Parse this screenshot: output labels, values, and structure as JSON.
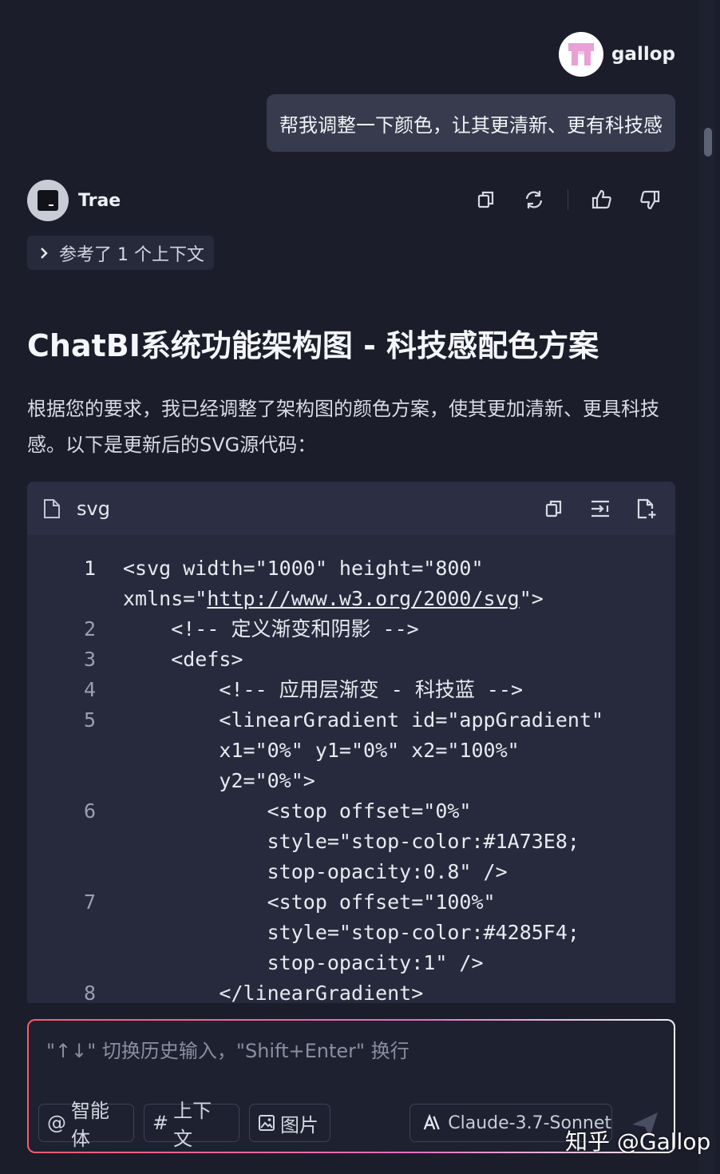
{
  "user": {
    "name": "gallop",
    "message": "帮我调整一下颜色，让其更清新、更有科技感"
  },
  "assistant": {
    "name": "Trae",
    "context_label": "参考了 1 个上下文",
    "title": "ChatBI系统功能架构图 - 科技感配色方案",
    "intro": "根据您的要求，我已经调整了架构图的颜色方案，使其更加清新、更具科技感。以下是更新后的SVG源代码："
  },
  "code": {
    "lang": "svg",
    "lines": [
      {
        "num": "1",
        "rows": [
          "<svg width=\"1000\" height=\"800\"",
          "xmlns=\"http://www.w3.org/2000/svg\">"
        ]
      },
      {
        "num": "2",
        "rows": [
          "    <!-- 定义渐变和阴影 -->"
        ]
      },
      {
        "num": "3",
        "rows": [
          "    <defs>"
        ]
      },
      {
        "num": "4",
        "rows": [
          "        <!-- 应用层渐变 - 科技蓝 -->"
        ]
      },
      {
        "num": "5",
        "rows": [
          "        <linearGradient id=\"appGradient\"",
          "        x1=\"0%\" y1=\"0%\" x2=\"100%\"",
          "        y2=\"0%\">"
        ]
      },
      {
        "num": "6",
        "rows": [
          "            <stop offset=\"0%\"",
          "            style=\"stop-color:#1A73E8;",
          "            stop-opacity:0.8\" />"
        ]
      },
      {
        "num": "7",
        "rows": [
          "            <stop offset=\"100%\"",
          "            style=\"stop-color:#4285F4;",
          "            stop-opacity:1\" />"
        ]
      },
      {
        "num": "8",
        "rows": [
          "        </linearGradient>"
        ]
      }
    ]
  },
  "input": {
    "placeholder": "\"↑↓\" 切换历史输入，\"Shift+Enter\" 换行",
    "chips": {
      "agent": "智能体",
      "context": "上下文",
      "image": "图片"
    },
    "agent_symbol": "@",
    "context_symbol": "#",
    "model": "Claude-3.7-Sonnet"
  },
  "watermark": "知乎 @Gallop",
  "colors": {
    "background": "#1b1d2a",
    "bubble": "#373b4d",
    "code_bg": "#272a3c",
    "input_border_start": "#ff5a6e",
    "input_border_end": "#e36fbf"
  },
  "icons": [
    "copy-icon",
    "regenerate-icon",
    "thumbs-up-icon",
    "thumbs-down-icon",
    "chevron-right-icon",
    "file-icon",
    "insert-icon",
    "new-file-icon",
    "image-icon",
    "model-icon",
    "send-icon"
  ]
}
